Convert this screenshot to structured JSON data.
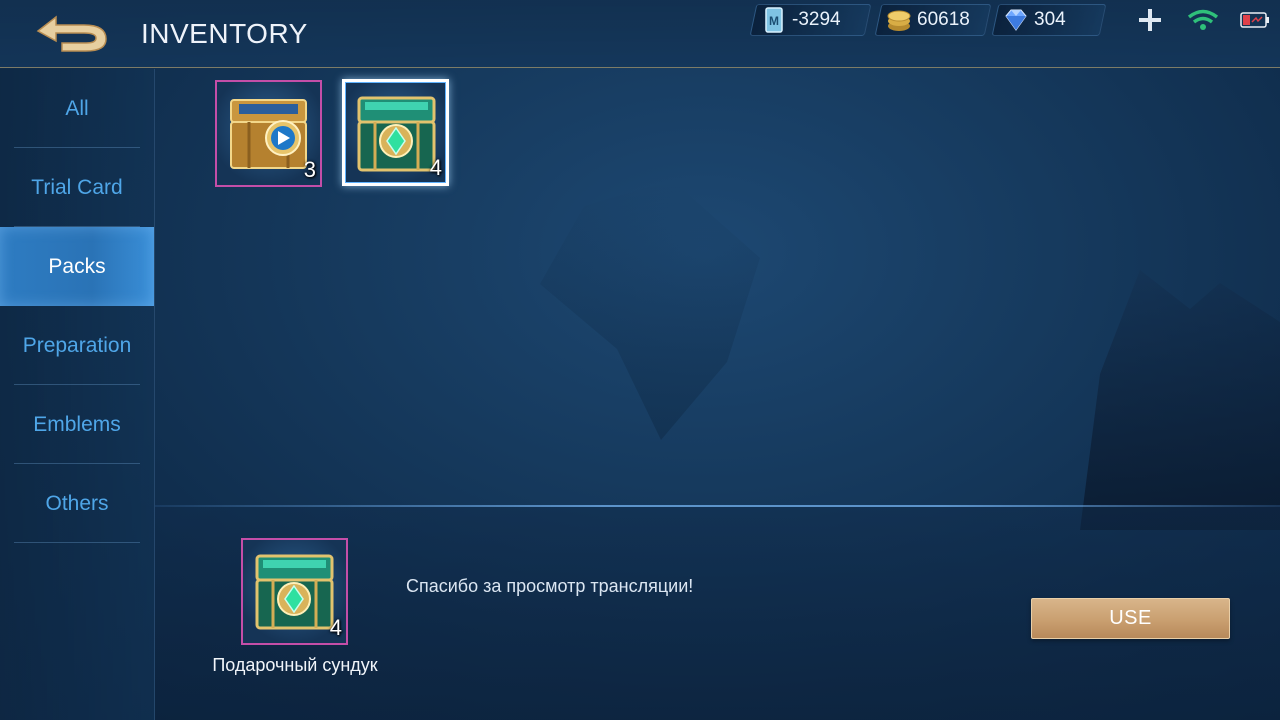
{
  "header": {
    "title": "INVENTORY",
    "back_icon": "back-arrow-icon"
  },
  "currencies": [
    {
      "name": "ticket",
      "icon": "ticket-icon",
      "value": "-3294"
    },
    {
      "name": "battle-points",
      "icon": "coins-icon",
      "value": "60618"
    },
    {
      "name": "diamonds",
      "icon": "diamond-icon",
      "value": "304"
    }
  ],
  "status": {
    "wifi_icon": "wifi-icon",
    "battery_icon": "battery-icon",
    "plus_icon": "plus-icon"
  },
  "sidebar": {
    "items": [
      {
        "label": "All",
        "active": false
      },
      {
        "label": "Trial Card",
        "active": false
      },
      {
        "label": "Packs",
        "active": true
      },
      {
        "label": "Preparation",
        "active": false
      },
      {
        "label": "Emblems",
        "active": false
      },
      {
        "label": "Others",
        "active": false
      }
    ]
  },
  "items": [
    {
      "icon": "gold-chest-play-icon",
      "count": "3",
      "selected": false
    },
    {
      "icon": "green-gem-chest-icon",
      "count": "4",
      "selected": true
    }
  ],
  "detail": {
    "icon": "green-gem-chest-icon",
    "count": "4",
    "name": "Подарочный сундук",
    "description": "Спасибо за просмотр трансляции!",
    "use_label": "USE"
  },
  "colors": {
    "accent_blue": "#4fa6e8",
    "active_tab": "#2e7cc2",
    "gold_button": "#c99f70",
    "rare_border": "#c44ea8"
  }
}
